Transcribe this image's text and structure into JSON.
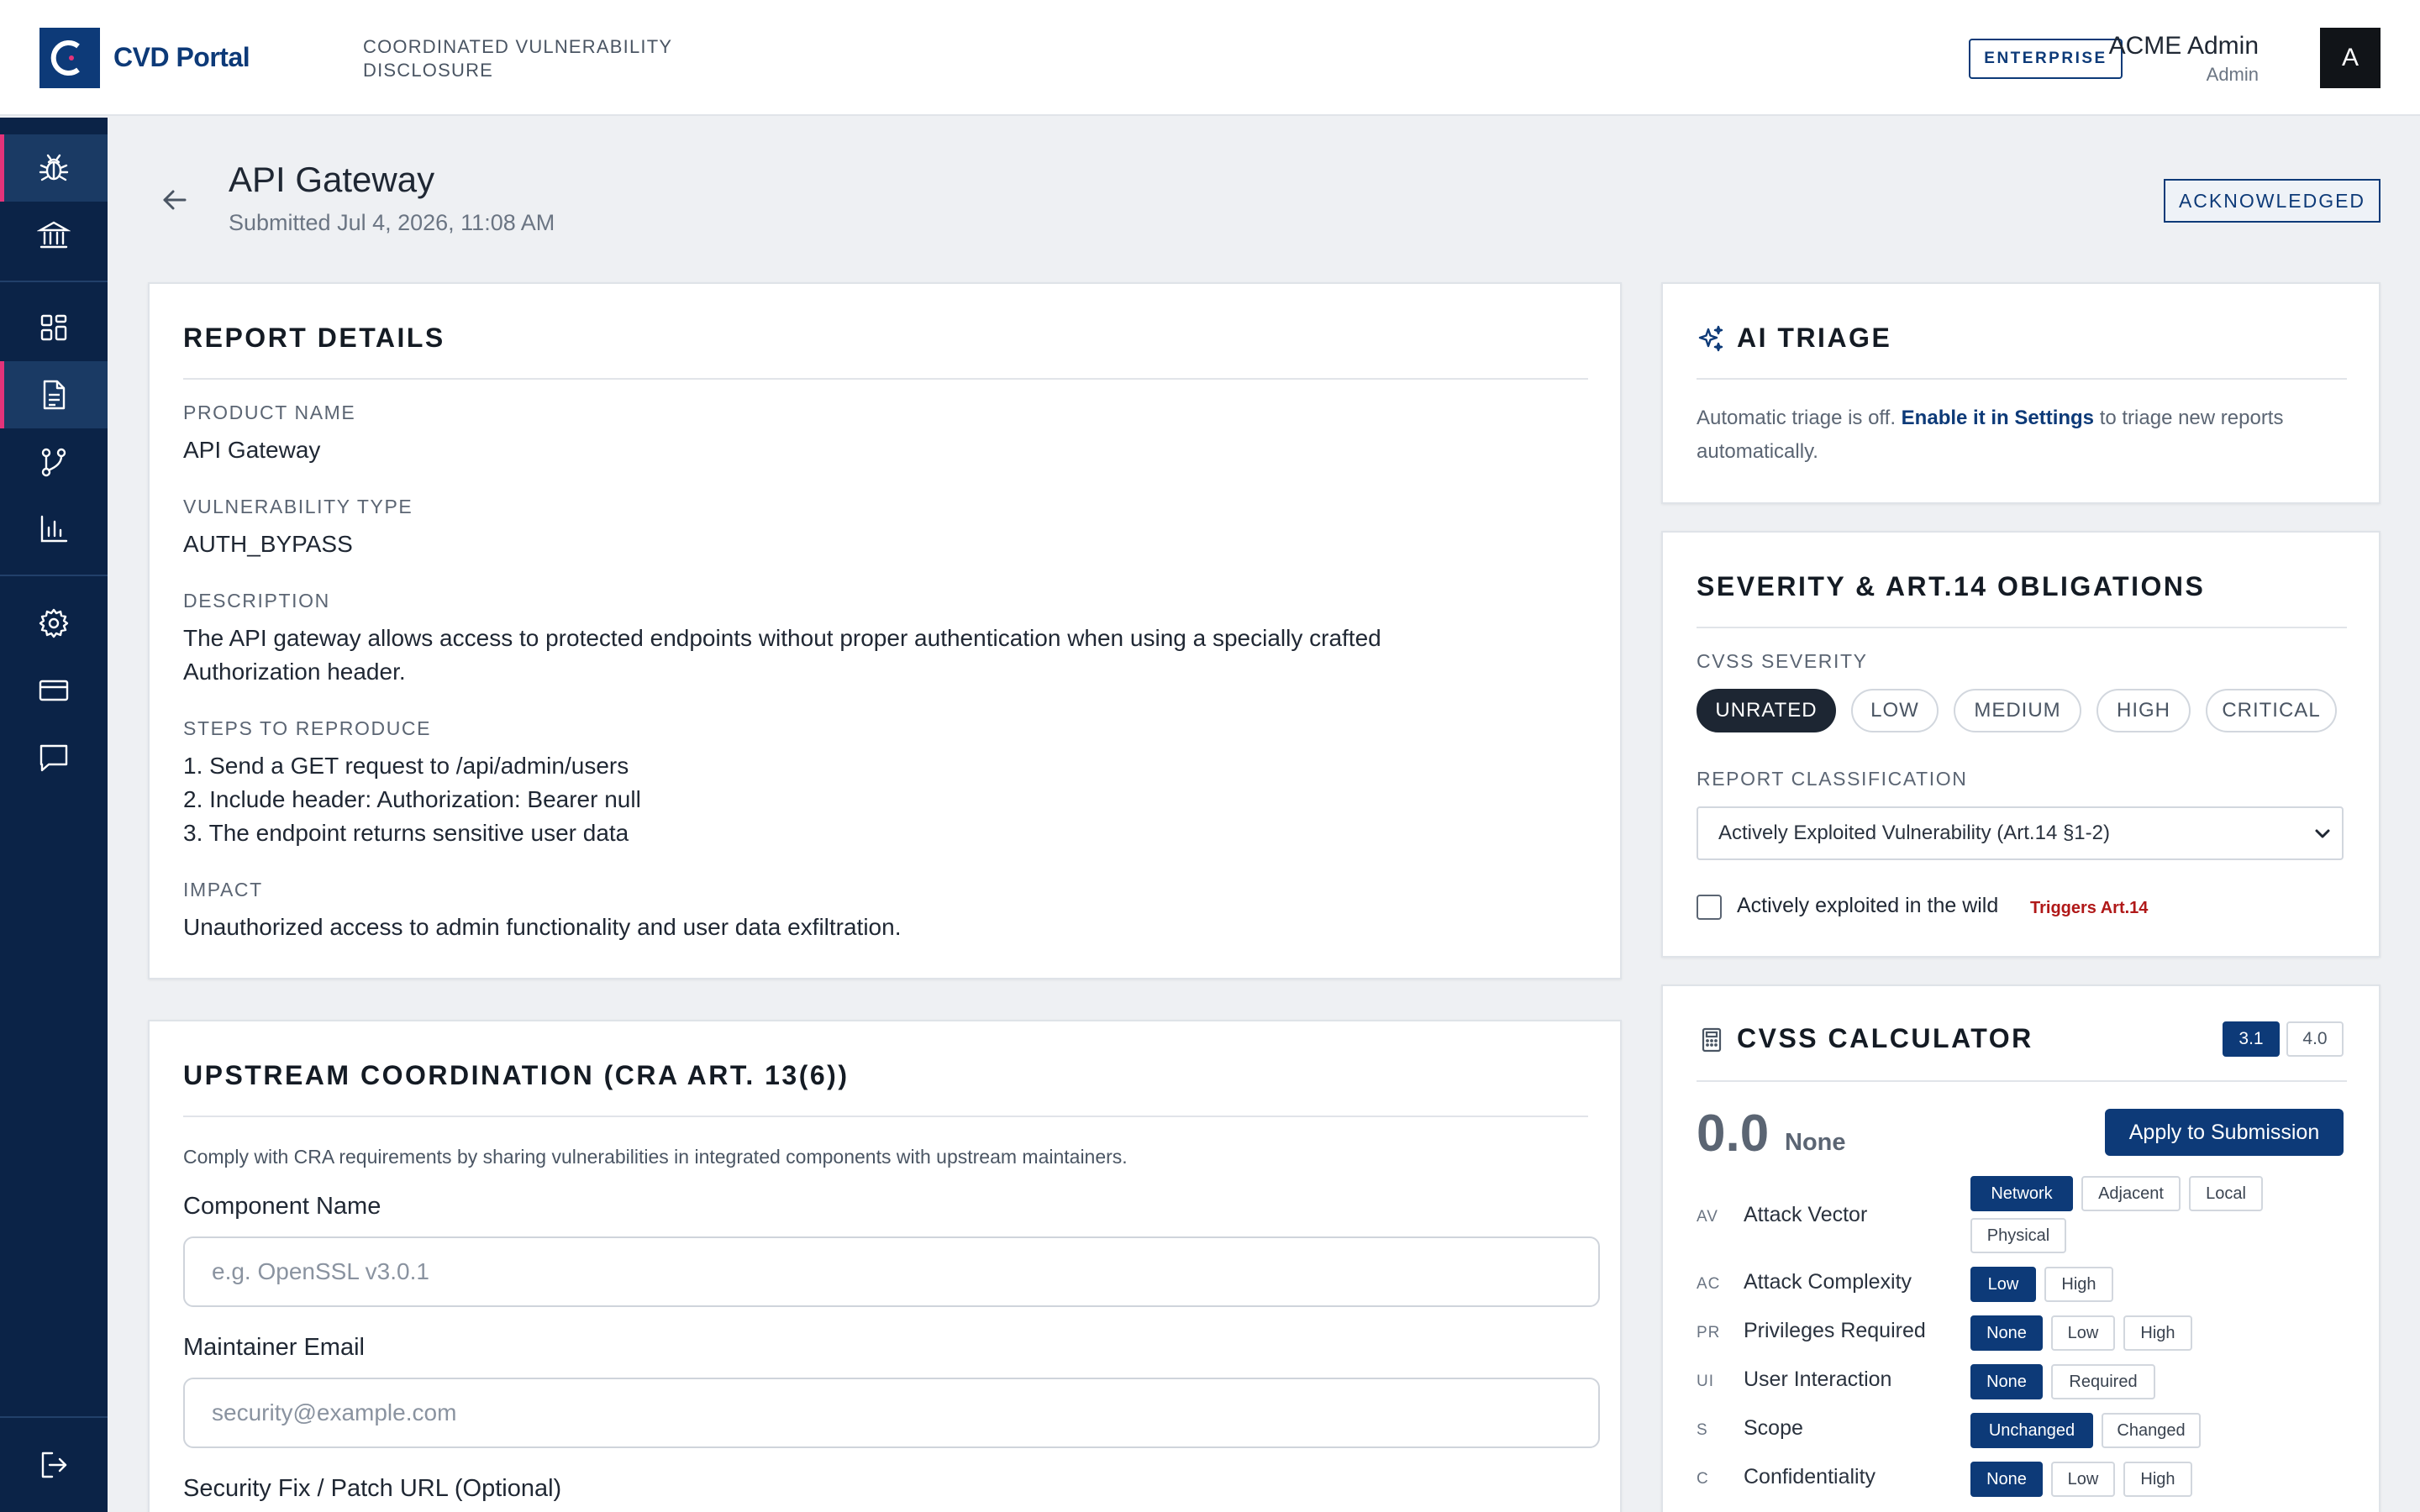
{
  "header": {
    "brand": "CVD Portal",
    "tagline": "Coordinated Vulnerability Disclosure",
    "plan": "ENTERPRISE",
    "user_name": "ACME Admin",
    "user_role": "Admin",
    "avatar_initial": "A"
  },
  "sidebar": {
    "items": [
      {
        "name": "bug-icon",
        "active": true
      },
      {
        "name": "bank-icon",
        "active": false
      },
      {
        "name": "dashboard-icon",
        "active": false
      },
      {
        "name": "document-icon",
        "active": true
      },
      {
        "name": "git-branch-icon",
        "active": false
      },
      {
        "name": "chart-icon",
        "active": false
      },
      {
        "name": "gear-icon",
        "active": false
      },
      {
        "name": "credit-card-icon",
        "active": false
      },
      {
        "name": "chat-icon",
        "active": false
      },
      {
        "name": "logout-icon",
        "active": false
      }
    ]
  },
  "page": {
    "title": "API Gateway",
    "submitted": "Submitted Jul 4, 2026, 11:08 AM",
    "status": "ACKNOWLEDGED"
  },
  "report": {
    "title": "REPORT DETAILS",
    "product_label": "PRODUCT NAME",
    "product_value": "API Gateway",
    "type_label": "VULNERABILITY TYPE",
    "type_value": "AUTH_BYPASS",
    "description_label": "DESCRIPTION",
    "description_line1": "The API gateway allows access to protected endpoints without proper authentication when using a specially crafted",
    "description_line2": "Authorization header.",
    "steps_label": "STEPS TO REPRODUCE",
    "steps": [
      "1. Send a GET request to /api/admin/users",
      "2. Include header: Authorization: Bearer null",
      "3. The endpoint returns sensitive user data"
    ],
    "impact_label": "IMPACT",
    "impact_value": "Unauthorized access to admin functionality and user data exfiltration."
  },
  "upstream": {
    "title": "UPSTREAM COORDINATION (CRA ART. 13(6))",
    "note": "Comply with CRA requirements by sharing vulnerabilities in integrated components with upstream maintainers.",
    "component_label": "Component Name",
    "component_placeholder": "e.g. OpenSSL v3.0.1",
    "component_value": "",
    "email_label": "Maintainer Email",
    "email_placeholder": "security@example.com",
    "email_value": "",
    "patch_label": "Security Fix / Patch URL (Optional)"
  },
  "triage": {
    "title": "AI TRIAGE",
    "text_before": "Automatic triage is off. ",
    "link": "Enable it in Settings",
    "text_after": " to triage new reports automatically."
  },
  "severity": {
    "title": "SEVERITY & ART.14 OBLIGATIONS",
    "cvss_label": "CVSS SEVERITY",
    "levels": [
      "UNRATED",
      "LOW",
      "MEDIUM",
      "HIGH",
      "CRITICAL"
    ],
    "selected": "UNRATED",
    "classification_label": "REPORT CLASSIFICATION",
    "classification_value": "Actively Exploited Vulnerability (Art.14 §1-2)",
    "exploited_label": "Actively exploited in the wild",
    "exploited_flag": "Triggers Art.14",
    "exploited_checked": false
  },
  "cvss": {
    "title": "CVSS CALCULATOR",
    "versions": [
      "3.1",
      "4.0"
    ],
    "selected_version": "3.1",
    "score": "0.0",
    "rating": "None",
    "apply_label": "Apply to Submission",
    "metrics": [
      {
        "abbr": "AV",
        "name": "Attack Vector",
        "options": [
          "Network",
          "Adjacent",
          "Local",
          "Physical"
        ],
        "selected": "Network"
      },
      {
        "abbr": "AC",
        "name": "Attack Complexity",
        "options": [
          "Low",
          "High"
        ],
        "selected": "Low"
      },
      {
        "abbr": "PR",
        "name": "Privileges Required",
        "options": [
          "None",
          "Low",
          "High"
        ],
        "selected": "None"
      },
      {
        "abbr": "UI",
        "name": "User Interaction",
        "options": [
          "None",
          "Required"
        ],
        "selected": "None"
      },
      {
        "abbr": "S",
        "name": "Scope",
        "options": [
          "Unchanged",
          "Changed"
        ],
        "selected": "Unchanged"
      },
      {
        "abbr": "C",
        "name": "Confidentiality",
        "options": [
          "None",
          "Low",
          "High"
        ],
        "selected": "None"
      }
    ]
  },
  "colors": {
    "brand": "#0d3a78",
    "sidebar": "#0b2347",
    "accent": "#e3337a",
    "danger": "#b01818"
  }
}
